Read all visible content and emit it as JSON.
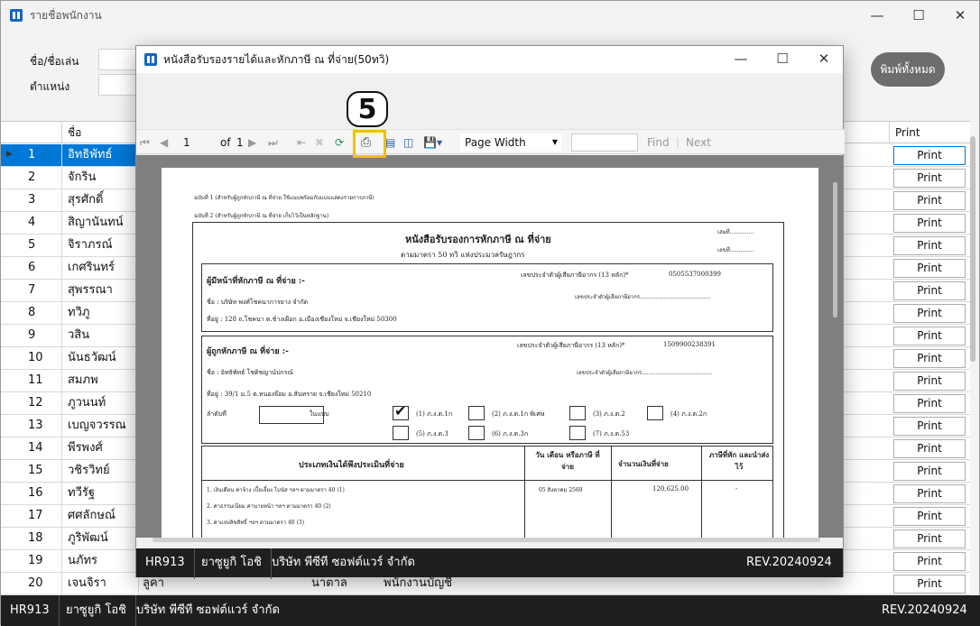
{
  "main_window": {
    "title": "รายชื่อพนักงาน",
    "filters": {
      "name_label": "ชื่อ/ชื่อเล่น",
      "position_label": "ตำแหน่ง"
    },
    "print_all_label": "พิมพ์ทั้งหมด",
    "grid": {
      "col_name": "ชื่อ",
      "col_print": "Print",
      "print_label": "Print",
      "rows": [
        {
          "no": "1",
          "name": "อิทธิพัทธ์"
        },
        {
          "no": "2",
          "name": "จักริน"
        },
        {
          "no": "3",
          "name": "สุรศักดิ์"
        },
        {
          "no": "4",
          "name": "สิญานันทน์"
        },
        {
          "no": "5",
          "name": "จิราภรณ์"
        },
        {
          "no": "6",
          "name": "เกศรินทร์"
        },
        {
          "no": "7",
          "name": "สุพรรณา"
        },
        {
          "no": "8",
          "name": "ทวิภู"
        },
        {
          "no": "9",
          "name": "วสิน"
        },
        {
          "no": "10",
          "name": "นันธวัฒน์"
        },
        {
          "no": "11",
          "name": "สมภพ"
        },
        {
          "no": "12",
          "name": "ภูวนนท์"
        },
        {
          "no": "13",
          "name": "เบญจวรรณ"
        },
        {
          "no": "14",
          "name": "พีรพงศ์"
        },
        {
          "no": "15",
          "name": "วชิรวิทย์"
        },
        {
          "no": "16",
          "name": "ทวีรัฐ"
        },
        {
          "no": "17",
          "name": "ศศลักษณ์"
        },
        {
          "no": "18",
          "name": "ภูริพัฒน์"
        },
        {
          "no": "19",
          "name": "นภัทร"
        },
        {
          "no": "20",
          "name": "เจนจิรา"
        }
      ],
      "row20_extra": {
        "col3": "ลูคา",
        "col4": "นาตาล",
        "col5": "พนักงานบัญชี"
      }
    },
    "status": {
      "code": "HR913",
      "user": "ยาซูยูกิ โอชิ",
      "company": "บริษัท พีซีที ซอฟต์แวร์ จำกัด",
      "rev": "REV.20240924"
    }
  },
  "dialog": {
    "title": "หนังสือรับรองรายได้และหักภาษี ณ ที่จ่าย(50ทวิ)",
    "toolbar": {
      "page_current": "1",
      "page_of": "of",
      "page_total": "1",
      "zoom": "Page Width",
      "find": "Find",
      "next": "Next"
    },
    "callout_number": "5",
    "status": {
      "code": "HR913",
      "user": "ยาซูยูกิ โอชิ",
      "company": "บริษัท พีซีที ซอฟต์แวร์ จำกัด",
      "rev": "REV.20240924"
    }
  },
  "document": {
    "copy1": "ฉบับที่ 1 (สำหรับผู้ถูกหักภาษี ณ ที่จ่าย ใช้แนบพร้อมกับแบบแสดงรายการภาษี)",
    "copy2": "ฉบับที่ 2 (สำหรับผู้ถูกหักภาษี ณ ที่จ่าย เก็บไว้เป็นหลักฐาน)",
    "title": "หนังสือรับรองการหักภาษี ณ ที่จ่าย",
    "subtitle": "ตามมาตรา 50 ทวิ แห่งประมวลรัษฎากร",
    "book_no": "เล่มที่..............",
    "no": "เลขที่..............",
    "payer_heading": "ผู้มีหน้าที่หักภาษี ณ ที่จ่าย :-",
    "payer_taxid_label": "เลขประจำตัวผู้เสียภาษีอากร (13 หลัก)*",
    "payer_taxid": "0505537000399",
    "payer_name": "ชื่อ : บริษัท พงศ์โชคนาการยาง จำกัด",
    "payer_taxid2": "เลขประจำตัวผู้เสียภาษีอากร.........................................",
    "payer_addr": "ที่อยู่ : 128 ถ.โชคนา ต.ช้างเผือก อ.เมืองเชียงใหม่ จ.เชียงใหม่ 50300",
    "payee_heading": "ผู้ถูกหักภาษี ณ ที่จ่าย :-",
    "payee_taxid_label": "เลขประจำตัวผู้เสียภาษีอากร (13 หลัก)*",
    "payee_taxid": "1509900238391",
    "payee_name": "ชื่อ : อิทธิพัทธ์ โชติชญาน์ปกรณ์",
    "payee_taxid2": "เลขประจำตัวผู้เสียภาษีอากร.........................................",
    "payee_addr": "ที่อยู่ : 39/1 ม.5 ต.หนองจ๊อม อ.สันทราย จ.เชียงใหม่ 50210",
    "seq_label": "ลำดับที่",
    "in_form": "ในแบบ",
    "forms": [
      "(1) ภ.ง.ด.1ก",
      "(2) ภ.ง.ด.1ก พิเศษ",
      "(3) ภ.ง.ด.2",
      "(4) ภ.ง.ด.2ก",
      "(5) ภ.ง.ด.3",
      "(6) ภ.ง.ด.3ก",
      "(7) ภ.ง.ด.53"
    ],
    "table_head": {
      "type": "ประเภทเงินได้พึงประเมินที่จ่าย",
      "date": "วัน เดือน หรือภาษี ที่จ่าย",
      "amount": "จำนวนเงินที่จ่าย",
      "tax": "ภาษีที่หัก และนำส่งไว้"
    },
    "rows": [
      {
        "type": "1. เงินเดือน ค่าจ้าง เบี้ยเลี้ยง โบนัส ฯลฯ ตามมาตรา 40 (1)",
        "date": "05 สิงหาคม 2569",
        "amount": "120,625.00",
        "tax": "-"
      },
      {
        "type": "2. ค่าธรรมเนียม ค่านายหน้า ฯลฯ ตามมาตรา 40 (2)",
        "date": "",
        "amount": "",
        "tax": ""
      },
      {
        "type": "3. ค่าแห่งลิขสิทธิ์ ฯลฯ ตามมาตรา 40 (3)",
        "date": "",
        "amount": "",
        "tax": ""
      }
    ]
  }
}
